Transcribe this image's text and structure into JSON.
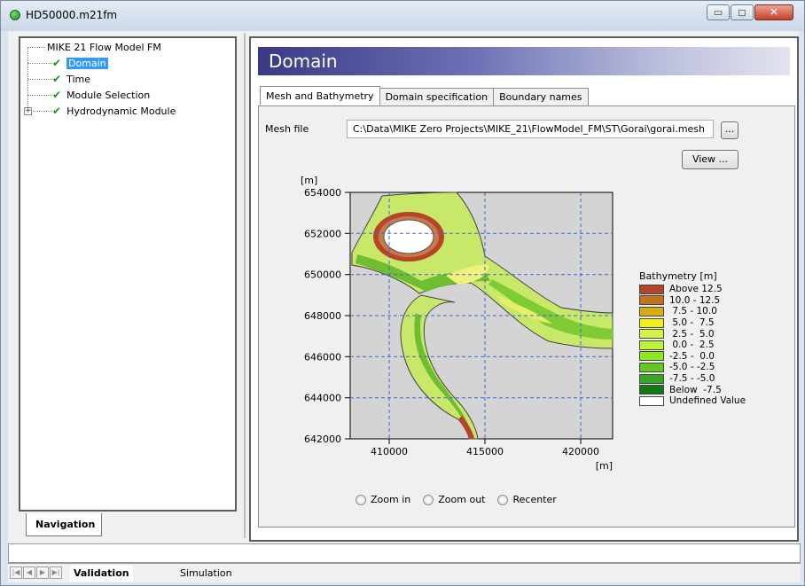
{
  "window": {
    "title": "HD50000.m21fm",
    "minimize_glyph": "▭",
    "maximize_glyph": "◻",
    "close_glyph": "✕"
  },
  "navigation": {
    "root": "MIKE 21 Flow Model FM",
    "items": [
      {
        "label": "Domain",
        "checked": true,
        "selected": true
      },
      {
        "label": "Time",
        "checked": true
      },
      {
        "label": "Module Selection",
        "checked": true
      },
      {
        "label": "Hydrodynamic Module",
        "checked": true,
        "expandable": true
      }
    ],
    "check_glyph": "✔",
    "expander_glyph": "+",
    "tab_label": "Navigation"
  },
  "main": {
    "header": "Domain",
    "tabs": [
      "Mesh and Bathymetry",
      "Domain specification",
      "Boundary names"
    ],
    "active_tab": 0,
    "mesh_file_label": "Mesh file",
    "mesh_file_value": "C:\\Data\\MIKE Zero Projects\\MIKE_21\\FlowModel_FM\\ST\\Gorai\\gorai.mesh",
    "browse_label": "...",
    "view_label": "View ...",
    "zoom": {
      "zoom_in": "Zoom in",
      "zoom_out": "Zoom out",
      "recenter": "Recenter"
    }
  },
  "plot": {
    "y_unit": "[m]",
    "x_unit": "[m]",
    "y_ticks": [
      "654000",
      "652000",
      "650000",
      "648000",
      "646000",
      "644000",
      "642000"
    ],
    "x_ticks": [
      "410000",
      "415000",
      "420000"
    ]
  },
  "chart_data": {
    "type": "heatmap",
    "ylabel": "[m]",
    "xlabel": "[m]",
    "xlim": [
      407500,
      421200
    ],
    "ylim": [
      642000,
      654000
    ],
    "x_ticks": [
      410000,
      415000,
      420000
    ],
    "y_ticks": [
      642000,
      644000,
      646000,
      648000,
      650000,
      652000,
      654000
    ],
    "grid": true,
    "legend_placement": "right",
    "legend": {
      "title": "Bathymetry [m]",
      "entries": [
        {
          "label": "Above 12.5",
          "color": "#b5452a"
        },
        {
          "label": "10.0 - 12.5",
          "color": "#c4741c"
        },
        {
          "label": " 7.5 - 10.0",
          "color": "#d7ad14"
        },
        {
          "label": " 5.0 -  7.5",
          "color": "#f2ee1a"
        },
        {
          "label": " 2.5 -  5.0",
          "color": "#d6f24a"
        },
        {
          "label": " 0.0 -  2.5",
          "color": "#bff23a"
        },
        {
          "label": "-2.5 -  0.0",
          "color": "#8fe61c"
        },
        {
          "label": "-5.0 - -2.5",
          "color": "#62c820"
        },
        {
          "label": "-7.5 - -5.0",
          "color": "#3aa627"
        },
        {
          "label": "Below  -7.5",
          "color": "#137a12"
        },
        {
          "label": "Undefined Value",
          "color": "#ffffff"
        }
      ]
    }
  },
  "bottom": {
    "tabs": [
      "Validation",
      "Simulation"
    ],
    "active": 0
  }
}
